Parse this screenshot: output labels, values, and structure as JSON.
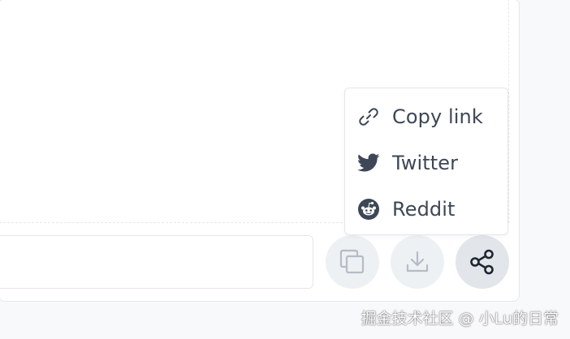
{
  "share_menu": {
    "items": [
      {
        "label": "Copy link",
        "icon": "link-icon"
      },
      {
        "label": "Twitter",
        "icon": "twitter-icon"
      },
      {
        "label": "Reddit",
        "icon": "reddit-icon"
      }
    ]
  },
  "toolbar": {
    "copy_icon": "copy-icon",
    "download_icon": "download-icon",
    "share_icon": "share-icon"
  },
  "colors": {
    "text": "#3d4756",
    "icon_muted": "#b4bcc6",
    "icon_dark": "#1f2630",
    "button_bg": "#eef1f4",
    "button_active_bg": "#e2e6eb"
  },
  "watermark": "掘金技术社区 @ 小Lu的日常"
}
